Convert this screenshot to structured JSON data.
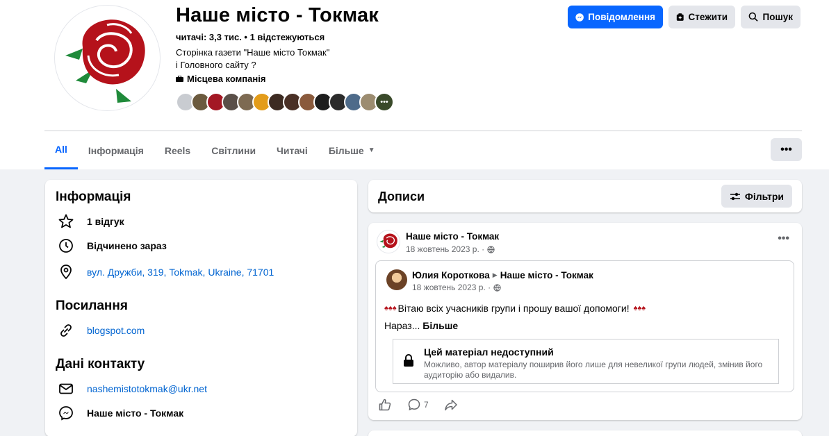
{
  "page": {
    "name": "Наше місто - Токмак",
    "followers": "читачі: 3,3 тис. • 1 відстежуються",
    "bio_line1": "Сторінка газети \"Наше місто Токмак\"",
    "bio_line2": "і Головного сайту ?",
    "category": "Місцева компанія"
  },
  "actions": {
    "message": "Повідомлення",
    "follow": "Стежити",
    "search": "Пошук"
  },
  "tabs": [
    {
      "label": "All"
    },
    {
      "label": "Інформація"
    },
    {
      "label": "Reels"
    },
    {
      "label": "Світлини"
    },
    {
      "label": "Читачі"
    },
    {
      "label": "Більше"
    }
  ],
  "info": {
    "title": "Інформація",
    "review": "1 відгук",
    "hours": "Відчинено зараз",
    "address": "вул. Дружби, 319, Tokmak, Ukraine, 71701",
    "links_title": "Посилання",
    "website": "blogspot.com",
    "contacts_title": "Дані контакту",
    "email": "nashemistotokmak@ukr.net",
    "messenger": "Наше місто - Токмак"
  },
  "posts": {
    "title": "Дописи",
    "filter": "Фільтри",
    "post": {
      "author": "Наше місто - Токмак",
      "date": "18 жовтень 2023 р. ·",
      "shared_author": "Юлия Короткова",
      "shared_target": "Наше місто - Токмак",
      "shared_date": "18 жовтень 2023 р. ·",
      "text": "Вітаю всіх учасників групи і прошу вашої допомоги!",
      "more_prefix": "Нараз...",
      "more_label": "Більше",
      "unavailable_title": "Цей матеріал недоступний",
      "unavailable_desc": "Можливо, автор матеріалу поширив його лише для невеликої групи людей, змінив його аудиторію або видалив.",
      "comments": "7"
    }
  },
  "colors": {
    "brand_blue": "#0866ff",
    "link": "#0064d1",
    "rose_red": "#b5121b"
  }
}
